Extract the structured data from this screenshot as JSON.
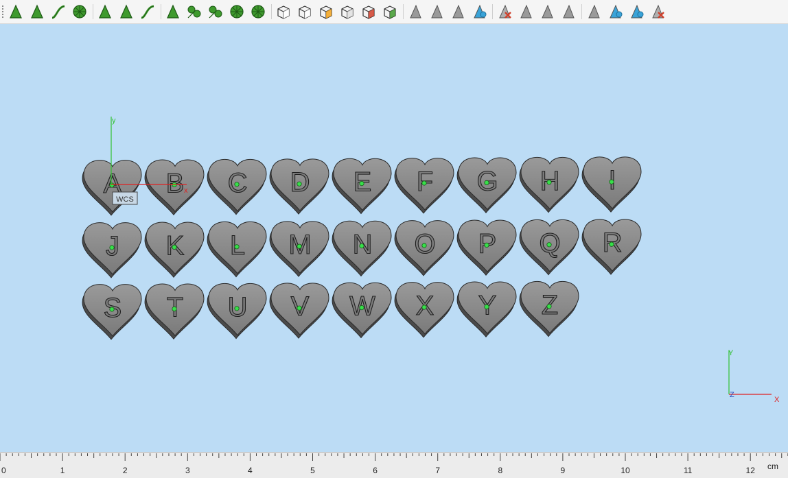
{
  "toolbar": {
    "groups": [
      [
        {
          "name": "sketch-arrow-icon",
          "color": "#3f9a2e"
        },
        {
          "name": "sketch-face-icon",
          "color": "#3f9a2e"
        },
        {
          "name": "sweep-curve-icon",
          "color": "#3f9a2e"
        },
        {
          "name": "revolve-icon",
          "color": "#3f9a2e"
        }
      ],
      [
        {
          "name": "rectangle-sketch-icon",
          "color": "#3f9a2e"
        },
        {
          "name": "blend-icon",
          "color": "#3f9a2e"
        },
        {
          "name": "spline-icon",
          "color": "#3f9a2e"
        }
      ],
      [
        {
          "name": "mesh-surface-icon",
          "color": "#3f9a2e"
        },
        {
          "name": "node-sphere-icon",
          "color": "#3f9a2e"
        },
        {
          "name": "split-star-icon",
          "color": "#3f9a2e"
        },
        {
          "name": "radial-pattern-icon",
          "color": "#3f9a2e"
        },
        {
          "name": "circular-array-icon",
          "color": "#3f9a2e"
        }
      ],
      [
        {
          "name": "box-select-icon",
          "color": "#ffffff"
        },
        {
          "name": "box-select-faces-icon",
          "color": "#ffffff"
        },
        {
          "name": "box-highlight-icon",
          "color": "#f2a21b"
        },
        {
          "name": "box-outline-icon",
          "color": "#e0e0e0"
        },
        {
          "name": "box-red-point-icon",
          "color": "#d0402b"
        },
        {
          "name": "box-green-icon",
          "color": "#3f9a2e"
        }
      ],
      [
        {
          "name": "cursor-gray-icon",
          "color": "#9a9a9a"
        },
        {
          "name": "cursor-extrude-icon",
          "color": "#9a9a9a"
        },
        {
          "name": "cursor-slice-icon",
          "color": "#9a9a9a"
        },
        {
          "name": "cursor-dual-icon",
          "color": "#3aa3d8"
        }
      ],
      [
        {
          "name": "delete-red-icon",
          "color": "#d0402b"
        },
        {
          "name": "dashed-triangle-icon",
          "color": "#9a9a9a"
        },
        {
          "name": "copy-triangle-icon",
          "color": "#9a9a9a"
        },
        {
          "name": "parallelogram-icon",
          "color": "#9a9a9a"
        }
      ],
      [
        {
          "name": "light-ray-icon",
          "color": "#9a9a9a"
        },
        {
          "name": "layered-view-icon",
          "color": "#3aa3d8"
        },
        {
          "name": "eye-triangle-icon",
          "color": "#3aa3d8"
        },
        {
          "name": "parallelogram-red-icon",
          "color": "#d0402b"
        }
      ]
    ]
  },
  "viewport": {
    "background": "#bcdcf5",
    "hearts": [
      {
        "letter": "A"
      },
      {
        "letter": "B"
      },
      {
        "letter": "C"
      },
      {
        "letter": "D"
      },
      {
        "letter": "E"
      },
      {
        "letter": "F"
      },
      {
        "letter": "G"
      },
      {
        "letter": "H"
      },
      {
        "letter": "I"
      },
      {
        "letter": "J"
      },
      {
        "letter": "K"
      },
      {
        "letter": "L"
      },
      {
        "letter": "M"
      },
      {
        "letter": "N"
      },
      {
        "letter": "O"
      },
      {
        "letter": "P"
      },
      {
        "letter": "Q"
      },
      {
        "letter": "R"
      },
      {
        "letter": "S"
      },
      {
        "letter": "T"
      },
      {
        "letter": "U"
      },
      {
        "letter": "V"
      },
      {
        "letter": "W"
      },
      {
        "letter": "X"
      },
      {
        "letter": "Y"
      },
      {
        "letter": "Z"
      }
    ],
    "wcs": {
      "label": "WCS",
      "x_label": "x",
      "y_label": "y"
    },
    "view_triad": {
      "x_label": "X",
      "y_label": "Y",
      "z_label": "Z"
    },
    "colors": {
      "heart_fill": "#878787",
      "heart_shadow": "#4a4a4a",
      "marker": "#37e04a",
      "x_axis": "#e02020",
      "y_axis": "#30c030"
    }
  },
  "ruler": {
    "labels": [
      "0",
      "1",
      "2",
      "3",
      "4",
      "5",
      "6",
      "7",
      "8",
      "9",
      "10",
      "11",
      "12"
    ],
    "unit": "cm"
  }
}
